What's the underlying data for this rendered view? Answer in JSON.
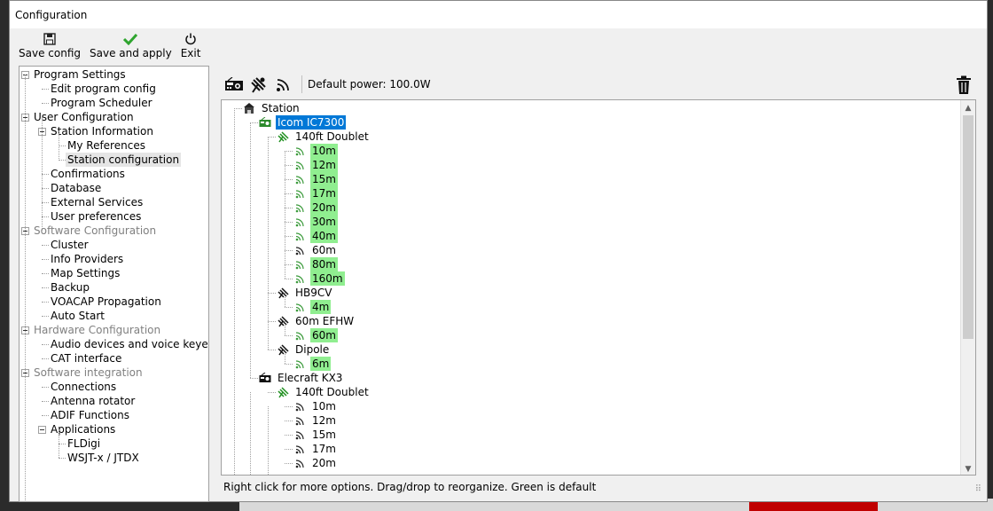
{
  "window": {
    "title": "Configuration"
  },
  "toolbar": {
    "save_config": "Save config",
    "save_apply": "Save and apply",
    "exit": "Exit"
  },
  "left_tree": [
    {
      "label": "Program Settings",
      "level": 0,
      "expander": true,
      "gray": false
    },
    {
      "label": "Edit program config",
      "level": 1
    },
    {
      "label": "Program Scheduler",
      "level": 1
    },
    {
      "label": "User Configuration",
      "level": 0,
      "expander": true
    },
    {
      "label": "Station Information",
      "level": 1,
      "expander": true
    },
    {
      "label": "My References",
      "level": 2
    },
    {
      "label": "Station configuration",
      "level": 2,
      "selected": true
    },
    {
      "label": "Confirmations",
      "level": 1
    },
    {
      "label": "Database",
      "level": 1
    },
    {
      "label": "External Services",
      "level": 1
    },
    {
      "label": "User preferences",
      "level": 1
    },
    {
      "label": "Software Configuration",
      "level": 0,
      "expander": true,
      "gray": true
    },
    {
      "label": "Cluster",
      "level": 1
    },
    {
      "label": "Info Providers",
      "level": 1
    },
    {
      "label": "Map Settings",
      "level": 1
    },
    {
      "label": "Backup",
      "level": 1
    },
    {
      "label": "VOACAP Propagation",
      "level": 1
    },
    {
      "label": "Auto Start",
      "level": 1
    },
    {
      "label": "Hardware Configuration",
      "level": 0,
      "expander": true,
      "gray": true
    },
    {
      "label": "Audio devices and voice keyer",
      "level": 1
    },
    {
      "label": "CAT interface",
      "level": 1
    },
    {
      "label": "Software integration",
      "level": 0,
      "expander": true,
      "gray": true
    },
    {
      "label": "Connections",
      "level": 1
    },
    {
      "label": "Antenna rotator",
      "level": 1
    },
    {
      "label": "ADIF Functions",
      "level": 1
    },
    {
      "label": "Applications",
      "level": 1,
      "expander": true
    },
    {
      "label": "FLDigi",
      "level": 2
    },
    {
      "label": "WSJT-x / JTDX",
      "level": 2
    }
  ],
  "right_toolbar": {
    "default_power": "Default power: 100.0W",
    "icons": [
      "radio-icon",
      "antenna-icon",
      "band-icon"
    ]
  },
  "station_tree": [
    {
      "label": "Station",
      "level": 0,
      "icon": "station"
    },
    {
      "label": "Icom IC7300",
      "level": 1,
      "icon": "radio-green",
      "selected": true
    },
    {
      "label": "140ft Doublet",
      "level": 2,
      "icon": "antenna-green"
    },
    {
      "label": "10m",
      "level": 3,
      "icon": "band-green",
      "green": true
    },
    {
      "label": "12m",
      "level": 3,
      "icon": "band-green",
      "green": true
    },
    {
      "label": "15m",
      "level": 3,
      "icon": "band-green",
      "green": true
    },
    {
      "label": "17m",
      "level": 3,
      "icon": "band-green",
      "green": true
    },
    {
      "label": "20m",
      "level": 3,
      "icon": "band-green",
      "green": true
    },
    {
      "label": "30m",
      "level": 3,
      "icon": "band-green",
      "green": true
    },
    {
      "label": "40m",
      "level": 3,
      "icon": "band-green",
      "green": true
    },
    {
      "label": "60m",
      "level": 3,
      "icon": "band"
    },
    {
      "label": "80m",
      "level": 3,
      "icon": "band-green",
      "green": true
    },
    {
      "label": "160m",
      "level": 3,
      "icon": "band-green",
      "green": true
    },
    {
      "label": "HB9CV",
      "level": 2,
      "icon": "antenna"
    },
    {
      "label": "4m",
      "level": 3,
      "icon": "band-green",
      "green": true
    },
    {
      "label": "60m EFHW",
      "level": 2,
      "icon": "antenna"
    },
    {
      "label": "60m",
      "level": 3,
      "icon": "band-green",
      "green": true
    },
    {
      "label": "Dipole",
      "level": 2,
      "icon": "antenna"
    },
    {
      "label": "6m",
      "level": 3,
      "icon": "band-green",
      "green": true
    },
    {
      "label": "Elecraft KX3",
      "level": 1,
      "icon": "radio"
    },
    {
      "label": "140ft Doublet",
      "level": 2,
      "icon": "antenna-green"
    },
    {
      "label": "10m",
      "level": 3,
      "icon": "band"
    },
    {
      "label": "12m",
      "level": 3,
      "icon": "band"
    },
    {
      "label": "15m",
      "level": 3,
      "icon": "band"
    },
    {
      "label": "17m",
      "level": 3,
      "icon": "band"
    },
    {
      "label": "20m",
      "level": 3,
      "icon": "band"
    }
  ],
  "status": "Right click for more options. Drag/drop to reorganize. Green is default",
  "colors": {
    "default_green": "#90ee90",
    "selection_blue": "#0078d7",
    "gray_text": "#808080"
  }
}
